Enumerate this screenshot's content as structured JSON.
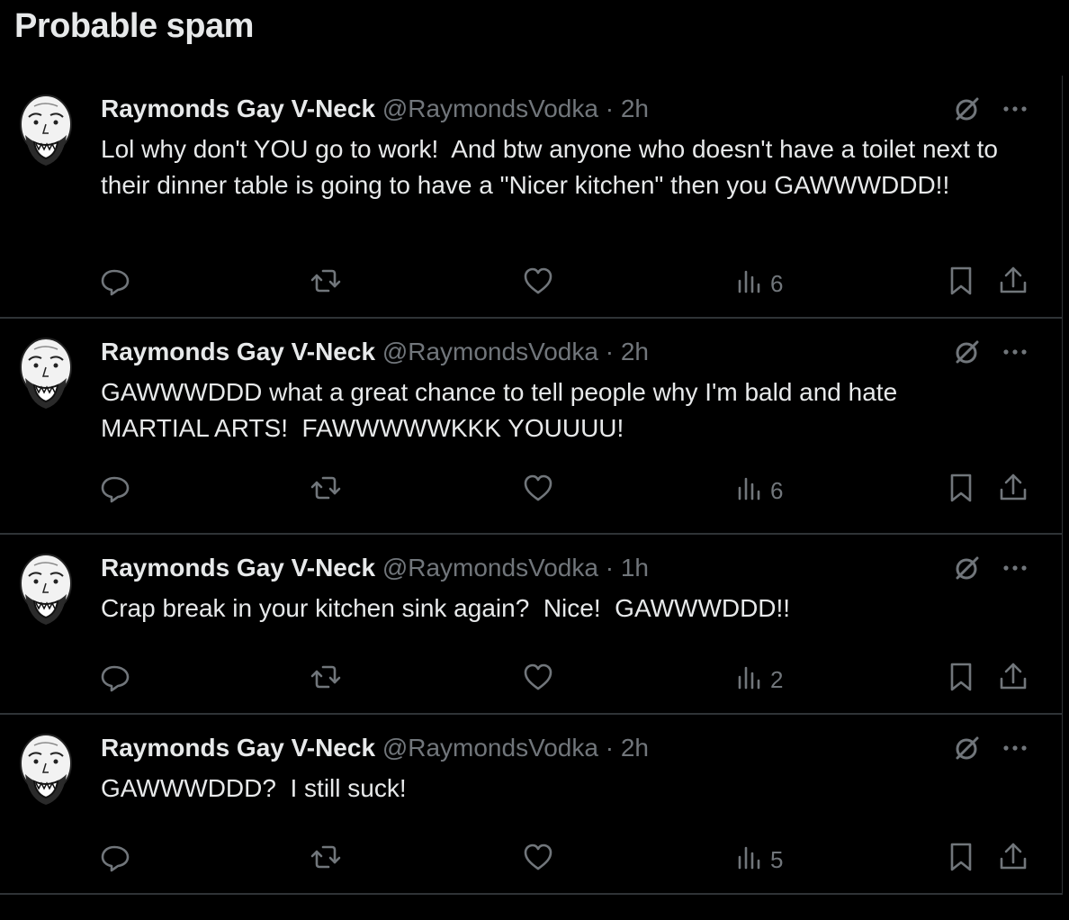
{
  "section_title": "Probable spam",
  "colors": {
    "background": "#000000",
    "text": "#e7e9ea",
    "muted": "#71767b",
    "divider": "#2f3336"
  },
  "icons": [
    "avatar",
    "grok-icon",
    "more-icon",
    "reply-icon",
    "retweet-icon",
    "like-icon",
    "views-icon",
    "bookmark-icon",
    "share-icon"
  ],
  "tweets": [
    {
      "name": "Raymonds Gay V-Neck",
      "handle": "@RaymondsVodka",
      "dot": "·",
      "time": "2h",
      "text": "Lol why don't YOU go to work!  And btw anyone who doesn't have a toilet next to their dinner table is going to have a \"Nicer kitchen\" then you GAWWWDDD!!",
      "views": "6"
    },
    {
      "name": "Raymonds Gay V-Neck",
      "handle": "@RaymondsVodka",
      "dot": "·",
      "time": "2h",
      "text": "GAWWWDDD what a great chance to tell people why I'm bald and hate MARTIAL ARTS!  FAWWWWWKKK YOUUUU!",
      "views": "6"
    },
    {
      "name": "Raymonds Gay V-Neck",
      "handle": "@RaymondsVodka",
      "dot": "·",
      "time": "1h",
      "text": "Crap break in your kitchen sink again?  Nice!  GAWWWDDD!!",
      "views": "2"
    },
    {
      "name": "Raymonds Gay V-Neck",
      "handle": "@RaymondsVodka",
      "dot": "·",
      "time": "2h",
      "text": "GAWWWDDD?  I still suck!",
      "views": "5"
    }
  ]
}
